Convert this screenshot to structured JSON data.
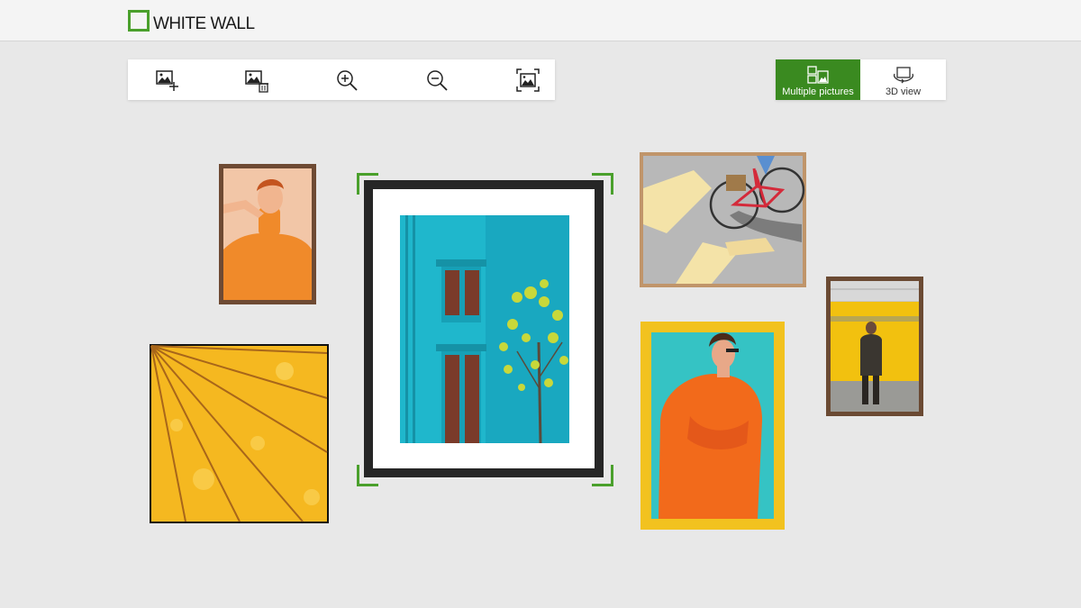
{
  "app": {
    "brand": "WHITE WALL",
    "brand_color": "#4aa02c"
  },
  "toolbar": {
    "buttons": [
      {
        "name": "add-picture-button",
        "icon": "add-image-icon"
      },
      {
        "name": "delete-picture-button",
        "icon": "delete-image-icon"
      },
      {
        "name": "zoom-in-button",
        "icon": "zoom-in-icon"
      },
      {
        "name": "zoom-out-button",
        "icon": "zoom-out-icon"
      },
      {
        "name": "fit-to-screen-button",
        "icon": "fit-screen-icon"
      }
    ]
  },
  "view_toggle": {
    "multiple_label": "Multiple pictures",
    "three_d_label": "3D view",
    "active": "multiple",
    "active_color": "#3a8a20"
  },
  "wall": {
    "pictures": [
      {
        "name": "picture-woman-orange-sweater",
        "frame": "dark wood",
        "selected": false
      },
      {
        "name": "picture-yellow-umbrella",
        "frame": "thin black",
        "selected": false
      },
      {
        "name": "picture-turquoise-building",
        "frame": "black with white mat",
        "selected": true
      },
      {
        "name": "picture-red-bicycle",
        "frame": "light wood",
        "selected": false
      },
      {
        "name": "picture-woman-orange-blazer",
        "frame": "yellow",
        "selected": false
      },
      {
        "name": "picture-man-subway",
        "frame": "dark wood",
        "selected": false
      }
    ]
  }
}
